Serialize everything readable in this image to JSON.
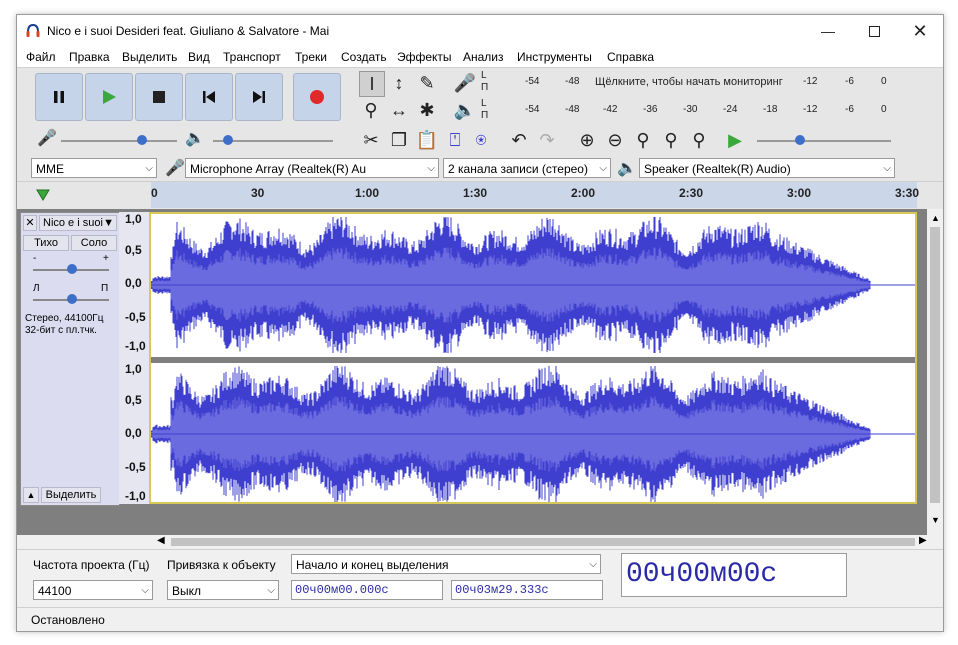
{
  "window": {
    "title": "Nico e i suoi Desideri feat. Giuliano & Salvatore - Mai"
  },
  "menu": [
    "Файл",
    "Правка",
    "Выделить",
    "Вид",
    "Транспорт",
    "Треки",
    "Создать",
    "Эффекты",
    "Анализ",
    "Инструменты",
    "Справка"
  ],
  "meters": {
    "record_scale": [
      "L",
      "П",
      "-54",
      "-48",
      "Щёлкните, чтобы начать мониторинг",
      "-12",
      "-6",
      "0"
    ],
    "play_scale": [
      "L",
      "П",
      "-54",
      "-48",
      "-42",
      "-36",
      "-30",
      "-24",
      "-18",
      "-12",
      "-6",
      "0"
    ],
    "monitor_hint": "Щёлкните, чтобы начать мониторинг"
  },
  "devices": {
    "host": "MME",
    "input": "Microphone Array (Realtek(R) Au",
    "channels": "2 канала записи (стерео)",
    "output": "Speaker (Realtek(R) Audio)"
  },
  "timeline": {
    "labels": [
      "0",
      "30",
      "1:00",
      "1:30",
      "2:00",
      "2:30",
      "3:00",
      "3:30"
    ]
  },
  "track": {
    "name": "Nico e i suoi",
    "mute": "Тихо",
    "solo": "Соло",
    "gain_minus": "-",
    "gain_plus": "+",
    "pan_left": "Л",
    "pan_right": "П",
    "info_line1": "Стерео, 44100Гц",
    "info_line2": "32-бит с пл.тчк.",
    "select": "Выделить",
    "scale": [
      "1,0",
      "0,5",
      "0,0",
      "-0,5",
      "-1,0"
    ]
  },
  "selection": {
    "rate_label": "Частота проекта (Гц)",
    "rate_value": "44100",
    "snap_label": "Привязка к объекту",
    "snap_value": "Выкл",
    "mode": "Начало и конец выделения",
    "start": "00ч00м00.000с",
    "end": "00ч03м29.333с",
    "position": "00ч00м00с"
  },
  "status": "Остановлено",
  "colors": {
    "wave": "#3f3fcf",
    "wave_inner": "#6b6be0",
    "ruler": "#cbd6e8",
    "selection_border": "#d8c85a"
  }
}
